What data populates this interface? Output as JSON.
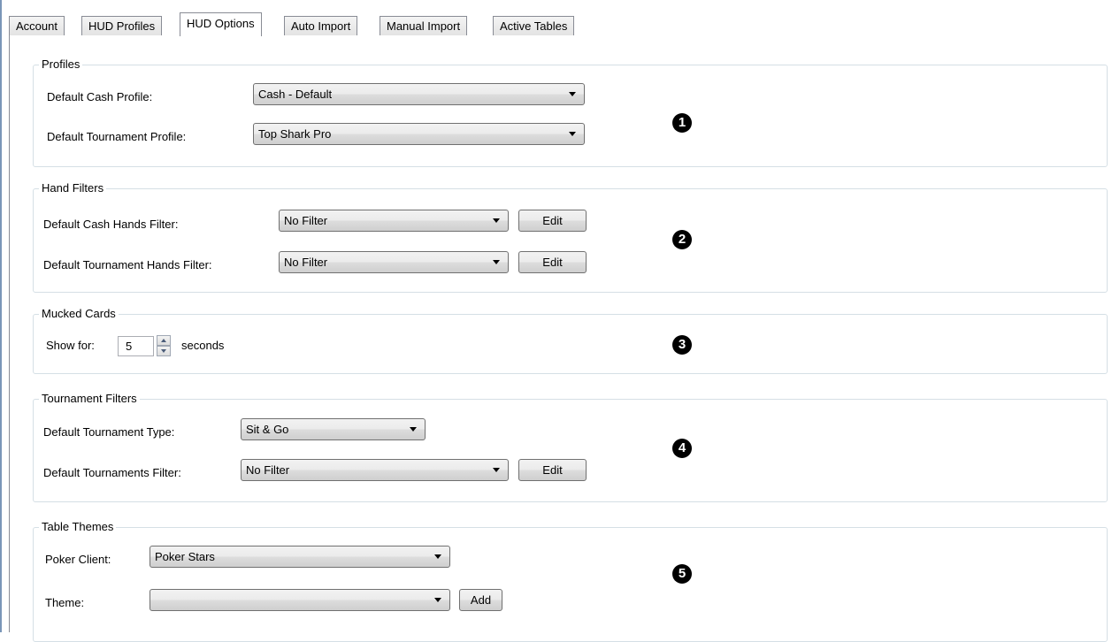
{
  "tabs": [
    {
      "label": "Account"
    },
    {
      "label": "HUD Profiles"
    },
    {
      "label": "HUD Options",
      "active": true
    },
    {
      "label": "Auto Import"
    },
    {
      "label": "Manual Import"
    },
    {
      "label": "Active Tables"
    }
  ],
  "profiles": {
    "title": "Profiles",
    "cash_label": "Default Cash Profile:",
    "cash_value": "Cash - Default",
    "tournament_label": "Default Tournament Profile:",
    "tournament_value": "Top Shark Pro",
    "badge": "1"
  },
  "hand_filters": {
    "title": "Hand Filters",
    "cash_label": "Default Cash Hands Filter:",
    "cash_value": "No Filter",
    "tournament_label": "Default Tournament Hands Filter:",
    "tournament_value": "No Filter",
    "edit_label": "Edit",
    "badge": "2"
  },
  "mucked_cards": {
    "title": "Mucked Cards",
    "show_for_label": "Show for:",
    "value": "5",
    "unit": "seconds",
    "badge": "3"
  },
  "tournament_filters": {
    "title": "Tournament Filters",
    "type_label": "Default Tournament Type:",
    "type_value": "Sit & Go",
    "filter_label": "Default Tournaments Filter:",
    "filter_value": "No Filter",
    "edit_label": "Edit",
    "badge": "4"
  },
  "table_themes": {
    "title": "Table Themes",
    "client_label": "Poker Client:",
    "client_value": "Poker Stars",
    "theme_label": "Theme:",
    "theme_value": "",
    "add_label": "Add",
    "badge": "5"
  },
  "colors": {
    "tab_border": "#898c95",
    "group_border": "#d5dfe5",
    "window_edge": "#7a96b8",
    "badge": "#000000"
  }
}
